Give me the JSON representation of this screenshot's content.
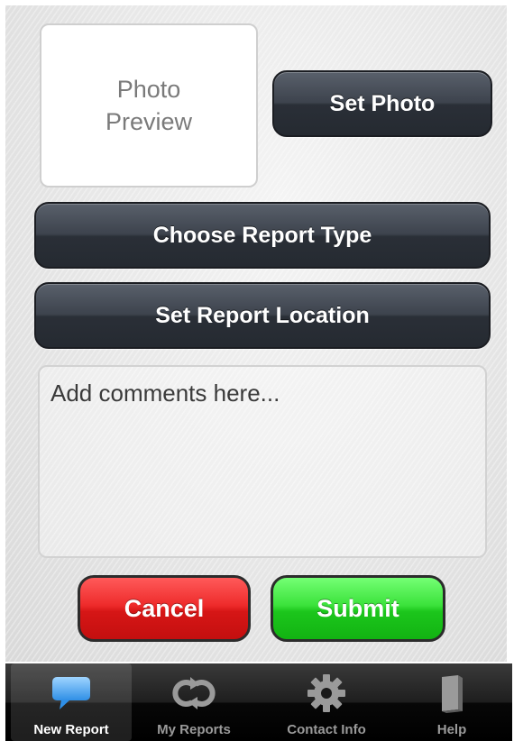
{
  "photo_preview": {
    "text": "Photo Preview"
  },
  "buttons": {
    "set_photo": "Set Photo",
    "choose_report_type": "Choose Report Type",
    "set_report_location": "Set Report Location",
    "cancel": "Cancel",
    "submit": "Submit"
  },
  "comments": {
    "placeholder": "Add comments here..."
  },
  "tabbar": {
    "tabs": [
      {
        "label": "New Report",
        "icon": "speech-bubble-icon",
        "active": true
      },
      {
        "label": "My Reports",
        "icon": "refresh-icon",
        "active": false
      },
      {
        "label": "Contact Info",
        "icon": "gear-icon",
        "active": false
      },
      {
        "label": "Help",
        "icon": "book-icon",
        "active": false
      }
    ]
  },
  "colors": {
    "cancel": "#e02121",
    "submit": "#2ad42a",
    "dark_button": "#3a3f48",
    "tabbar": "#1a1a1a"
  }
}
